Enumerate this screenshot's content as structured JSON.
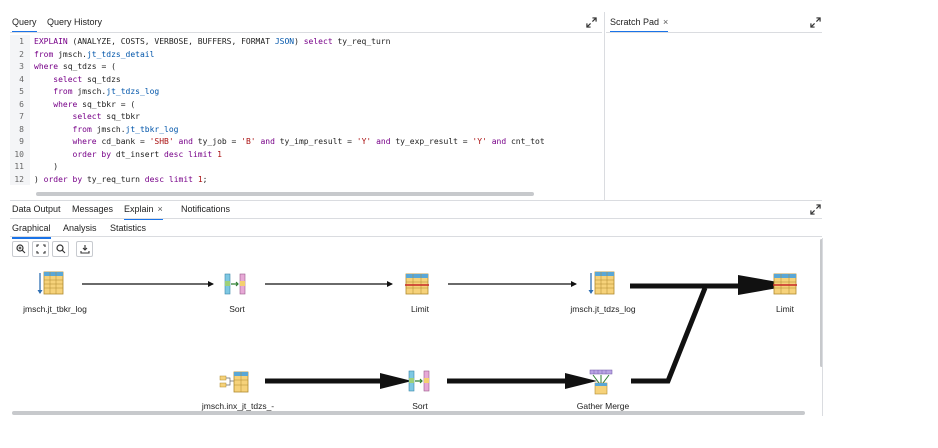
{
  "query_panel": {
    "tabs": [
      "Query",
      "Query History"
    ],
    "active_tab": "Query",
    "expand_icon": "expand-icon"
  },
  "scratch_panel": {
    "tab_label": "Scratch Pad",
    "close_glyph": "×",
    "expand_icon": "expand-icon"
  },
  "editor": {
    "line_numbers": [
      "1",
      "2",
      "3",
      "4",
      "5",
      "6",
      "7",
      "8",
      "9",
      "10",
      "11",
      "12"
    ],
    "lines": [
      [
        [
          "kw",
          "EXPLAIN"
        ],
        [
          "t",
          " (ANALYZE, COSTS, VERBOSE, BUFFERS, FORMAT "
        ],
        [
          "fn",
          "JSON"
        ],
        [
          "t",
          ") "
        ],
        [
          "kw",
          "select"
        ],
        [
          "t",
          " ty_req_turn"
        ]
      ],
      [
        [
          "kw",
          "from"
        ],
        [
          "t",
          " jmsch."
        ],
        [
          "fn",
          "jt_tdzs_detail"
        ]
      ],
      [
        [
          "kw",
          "where"
        ],
        [
          "t",
          " sq_tdzs = ("
        ]
      ],
      [
        [
          "t",
          "    "
        ],
        [
          "kw",
          "select"
        ],
        [
          "t",
          " sq_tdzs"
        ]
      ],
      [
        [
          "t",
          "    "
        ],
        [
          "kw",
          "from"
        ],
        [
          "t",
          " jmsch."
        ],
        [
          "fn",
          "jt_tdzs_log"
        ]
      ],
      [
        [
          "t",
          "    "
        ],
        [
          "kw",
          "where"
        ],
        [
          "t",
          " sq_tbkr = ("
        ]
      ],
      [
        [
          "t",
          "        "
        ],
        [
          "kw",
          "select"
        ],
        [
          "t",
          " sq_tbkr"
        ]
      ],
      [
        [
          "t",
          "        "
        ],
        [
          "kw",
          "from"
        ],
        [
          "t",
          " jmsch."
        ],
        [
          "fn",
          "jt_tbkr_log"
        ]
      ],
      [
        [
          "t",
          "        "
        ],
        [
          "kw",
          "where"
        ],
        [
          "t",
          " cd_bank = "
        ],
        [
          "str",
          "'SHB'"
        ],
        [
          "t",
          " "
        ],
        [
          "kw",
          "and"
        ],
        [
          "t",
          " ty_job = "
        ],
        [
          "str",
          "'B'"
        ],
        [
          "t",
          " "
        ],
        [
          "kw",
          "and"
        ],
        [
          "t",
          " ty_imp_result = "
        ],
        [
          "str",
          "'Y'"
        ],
        [
          "t",
          " "
        ],
        [
          "kw",
          "and"
        ],
        [
          "t",
          " ty_exp_result = "
        ],
        [
          "str",
          "'Y'"
        ],
        [
          "t",
          " "
        ],
        [
          "kw",
          "and"
        ],
        [
          "t",
          " cnt_tot "
        ]
      ],
      [
        [
          "t",
          "        "
        ],
        [
          "kw",
          "order by"
        ],
        [
          "t",
          " dt_insert "
        ],
        [
          "kw",
          "desc"
        ],
        [
          "t",
          " "
        ],
        [
          "kw",
          "limit"
        ],
        [
          "t",
          " "
        ],
        [
          "str",
          "1"
        ]
      ],
      [
        [
          "t",
          "    )"
        ]
      ],
      [
        [
          "t",
          ") "
        ],
        [
          "kw",
          "order by"
        ],
        [
          "t",
          " ty_req_turn "
        ],
        [
          "kw",
          "desc"
        ],
        [
          "t",
          " "
        ],
        [
          "kw",
          "limit"
        ],
        [
          "t",
          " "
        ],
        [
          "str",
          "1"
        ],
        [
          "t",
          ";"
        ]
      ]
    ]
  },
  "results": {
    "tabs": [
      "Data Output",
      "Messages",
      "Explain",
      "Notifications"
    ],
    "active_tab": "Explain",
    "close_glyph": "×",
    "subtabs": [
      "Graphical",
      "Analysis",
      "Statistics"
    ],
    "active_subtab": "Graphical",
    "toolbar_icons": [
      "zoom-in-icon",
      "zoom-to-fit-icon",
      "zoom-out-icon",
      "download-icon"
    ]
  },
  "plan_nodes": [
    {
      "id": "n1",
      "label": "jmsch.jt_tbkr_log",
      "icon": "seq-scan-icon"
    },
    {
      "id": "n2",
      "label": "Sort",
      "icon": "sort-icon"
    },
    {
      "id": "n3",
      "label": "Limit",
      "icon": "limit-icon"
    },
    {
      "id": "n4",
      "label": "jmsch.jt_tdzs_log",
      "icon": "seq-scan-icon"
    },
    {
      "id": "n5",
      "label": "Limit",
      "icon": "limit-icon"
    },
    {
      "id": "n6",
      "label": "jmsch.inx_jt_tdzs_-",
      "icon": "index-scan-icon"
    },
    {
      "id": "n7",
      "label": "Sort",
      "icon": "sort-icon"
    },
    {
      "id": "n8",
      "label": "Gather Merge",
      "icon": "gather-merge-icon"
    }
  ],
  "colors": {
    "accent": "#1a73e8",
    "keyword": "#770088",
    "function": "#0055aa",
    "string": "#aa1111"
  }
}
